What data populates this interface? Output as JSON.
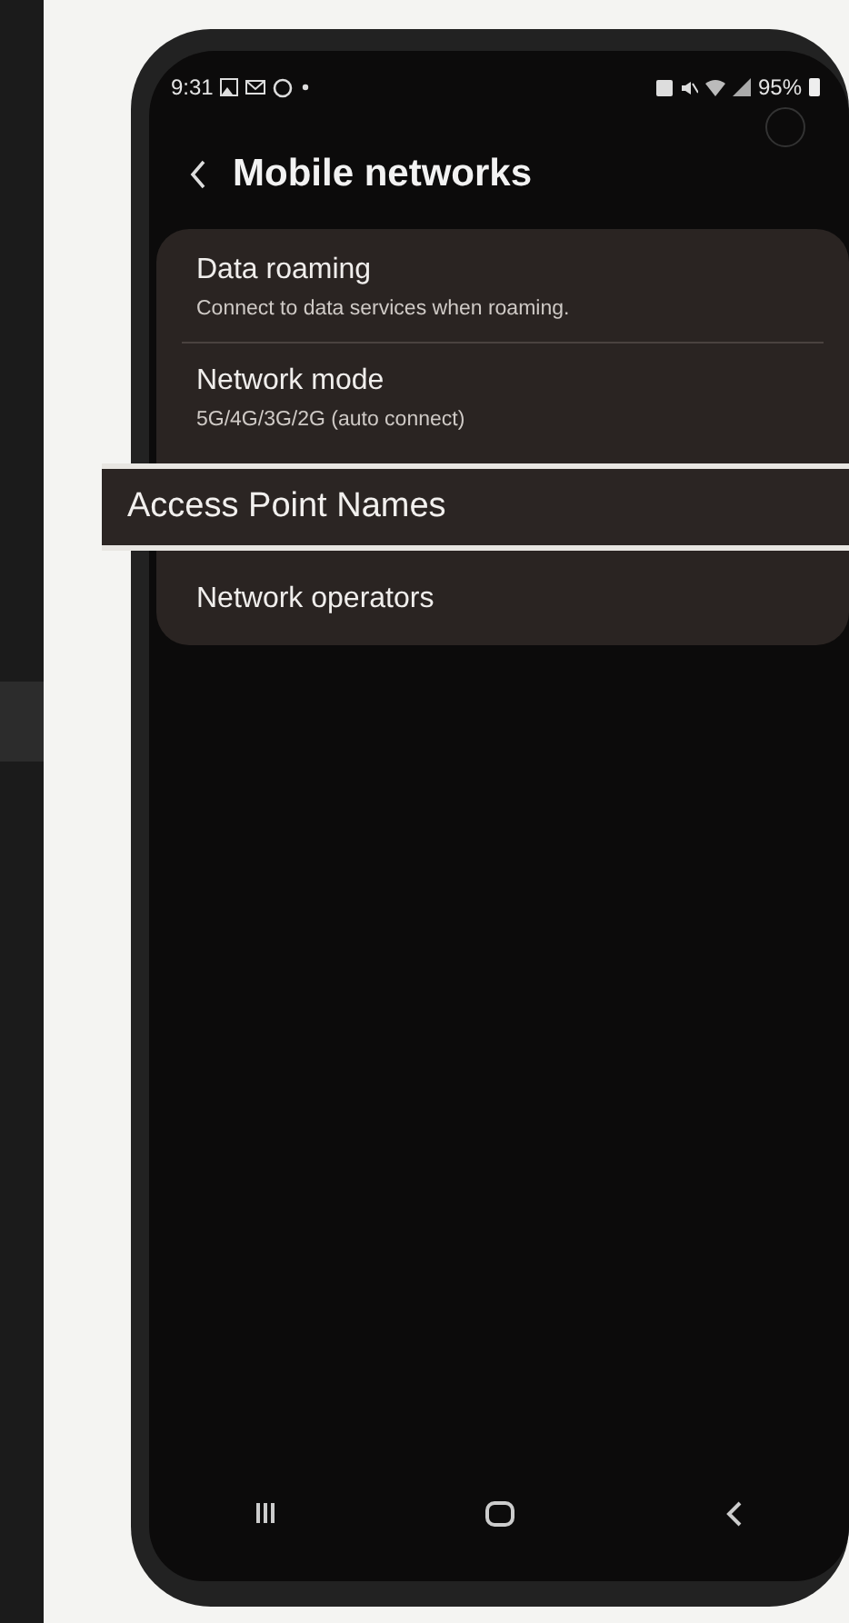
{
  "status_bar": {
    "time": "9:31",
    "battery": "95%"
  },
  "header": {
    "title": "Mobile networks"
  },
  "items": [
    {
      "kind": "setting",
      "title": "Data roaming",
      "subtitle": "Connect to data services when roaming."
    },
    {
      "kind": "setting",
      "title": "Network mode",
      "subtitle": "5G/4G/3G/2G (auto connect)"
    },
    {
      "kind": "highlight",
      "title": "Access Point Names"
    },
    {
      "kind": "setting",
      "title": "Network operators"
    }
  ]
}
